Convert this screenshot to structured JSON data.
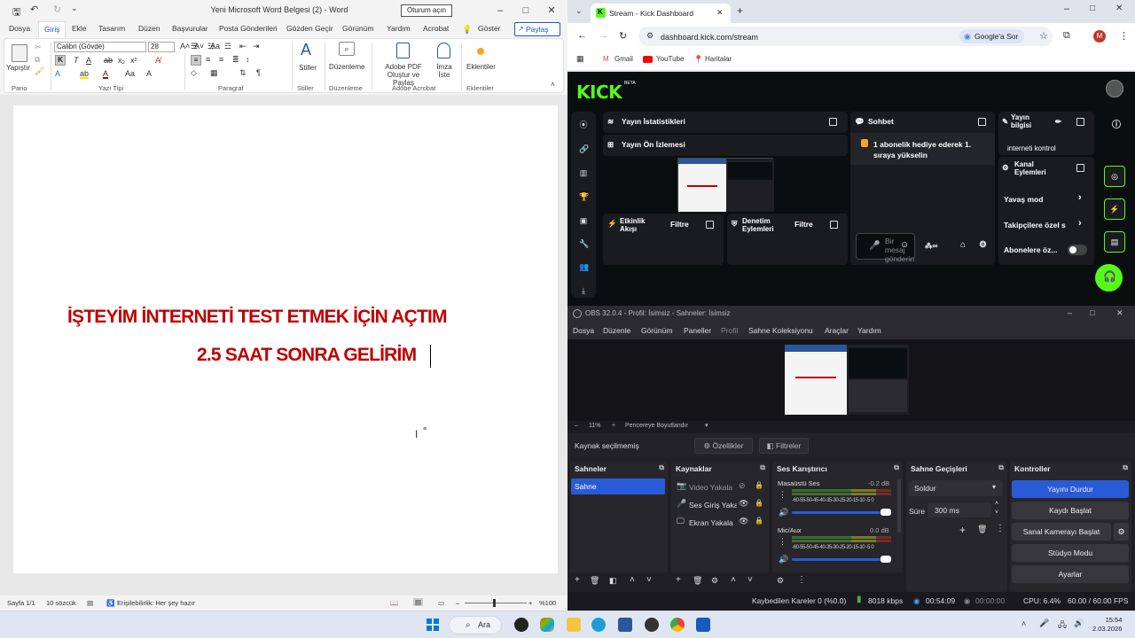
{
  "word": {
    "title": "Yeni Microsoft Word Belgesi (2)  -  Word",
    "signin": "Oturum açın",
    "tabs": [
      "Dosya",
      "Giriş",
      "Ekle",
      "Tasarım",
      "Düzen",
      "Başvurular",
      "Posta Gönderileri",
      "Gözden Geçir",
      "Görünüm",
      "Yardım",
      "Acrobat",
      "Göster"
    ],
    "share": "Paylaş",
    "ribbon": {
      "paste": "Yapıştır",
      "font_name": "Calibri (Gövde)",
      "font_size": "28",
      "styles": "Stiller",
      "editing": "Düzenleme",
      "adobe_pdf": "Adobe PDF Oluştur ve Paylaş",
      "sign": "İmza İste",
      "addins": "Eklentiler",
      "groups": {
        "clipboard": "Pano",
        "font": "Yazı Tipi",
        "paragraph": "Paragraf",
        "styles": "Stiller",
        "editing": "Düzenleme",
        "acrobat": "Adobe Acrobat",
        "addins": "Eklentiler"
      }
    },
    "document": {
      "line1": "İŞTEYİM İNTERNETİ TEST ETMEK İÇİN AÇTIM",
      "line2": "2.5 SAAT SONRA GELİRİM"
    },
    "status": {
      "page": "Sayfa 1/1",
      "words": "10 sözcük",
      "accessibility": "Erişilebilirlik: Her şey hazır",
      "zoom": "%100"
    }
  },
  "chrome": {
    "tab_title": "Stream - Kick Dashboard",
    "url": "dashboard.kick.com/stream",
    "google_btn": "Google'a Sor",
    "profile_initial": "M",
    "bookmarks": [
      "Gmail",
      "YouTube",
      "Haritalar"
    ],
    "kick": {
      "logo": "KICK",
      "logo_badge": "BETA",
      "stream_stats": "Yayın İstatistikleri",
      "stream_preview": "Yayın Ön İzlemesi",
      "activity_feed": "Etkinlik Akışı",
      "filter": "Filtre",
      "mod_actions": "Denetim Eylemleri",
      "chat": "Sohbet",
      "chat_message": "1 abonelik hediye ederek 1. sıraya yükselin",
      "chat_placeholder": "Bir mesaj gönderin",
      "stream_info": "Yayın bilgisi",
      "stream_info_value": "interneti kontrol",
      "channel_actions": "Kanal Eylemleri",
      "slow_mode": "Yavaş mod",
      "followers_only": "Takipçilere özel s",
      "subs_only": "Abonelere öz..."
    }
  },
  "obs": {
    "title": "OBS 32.0.4 - Profil: İsimsiz - Sahneler: İsimsiz",
    "menu": [
      "Dosya",
      "Düzenle",
      "Görünüm",
      "Paneller",
      "Profil",
      "Sahne Koleksiyonu",
      "Araçlar",
      "Yardım"
    ],
    "zoom": "11%",
    "fit": "Pencereye Boyutlandır",
    "no_source": "Kaynak seçilmemiş",
    "properties": "Özellikler",
    "filters": "Filtreler",
    "docks": {
      "scenes": "Sahneler",
      "sources": "Kaynaklar",
      "mixer": "Ses Karıştırıcı",
      "transitions": "Sahne Geçişleri",
      "controls": "Kontroller"
    },
    "scene": "Sahne",
    "sources": [
      "Video Yakala",
      "Ses Giriş Yaka",
      "Ekran Yakala"
    ],
    "mixer": [
      {
        "name": "Masaüstü Ses",
        "db": "-0.2 dB"
      },
      {
        "name": "Mic/Aux",
        "db": "0.0 dB"
      }
    ],
    "meter_ticks": "-60-55-50-45-40-35-30-25-20-15-10 -5  0",
    "transition": "Soldur",
    "duration_label": "Süre",
    "duration": "300 ms",
    "controls": [
      "Yayını Durdur",
      "Kaydı Başlat",
      "Sanal Kamerayı Başlat",
      "Stüdyo Modu",
      "Ayarlar"
    ],
    "status": {
      "dropped": "Kaybedilen Kareler 0 (%0.0)",
      "bitrate": "8018 kbps",
      "stream_time": "00:54:09",
      "rec_time": "00:00:00",
      "cpu": "CPU: 6.4%",
      "fps": "60.00 / 60.00 FPS"
    }
  },
  "taskbar": {
    "search": "Ara",
    "time": "15:54",
    "date": "2.03.2026"
  },
  "colors": {
    "word_blue": "#185abd",
    "doc_red": "#c00000",
    "kick_green": "#53fc18",
    "obs_accent": "#2a5bd7"
  }
}
